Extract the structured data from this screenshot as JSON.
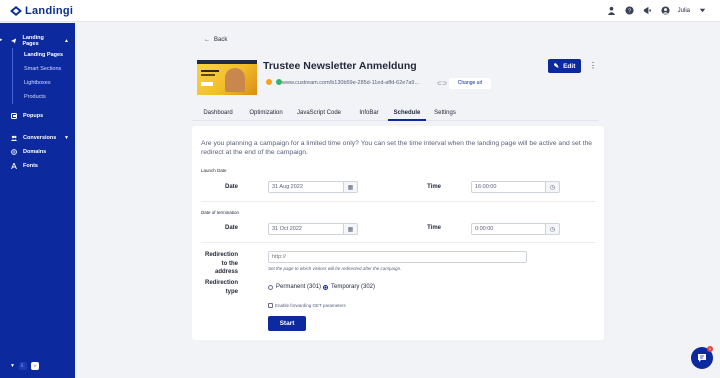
{
  "app": {
    "logo_text": "Landingi"
  },
  "header": {
    "user_name": "Julia"
  },
  "sidebar": {
    "landing_pages": "Landing Pages",
    "sub_items": [
      "Landing Pages",
      "Smart Sections",
      "Lightboxes",
      "Products"
    ],
    "popups": "Popups",
    "conversions": "Conversions",
    "domains": "Domains",
    "fonts": "Fonts"
  },
  "page": {
    "back": "Back",
    "title": "Trustee Newsletter Anmeldung",
    "url": "www.custream.com/b130b59e-285d-11ed-affd-62e7a9...",
    "change_url": "Change url",
    "edit": "Edit"
  },
  "tabs": [
    "Dashboard",
    "Optimization",
    "JavaScript Code",
    "InfoBar",
    "Schedule",
    "Settings"
  ],
  "active_tab": "Schedule",
  "schedule": {
    "intro": "Are you planning a campaign for a limited time only? You can set the time interval when the landing page will be active and set the redirect at the end of the campaign.",
    "launch_date_label": "Launch Date",
    "date_label": "Date",
    "time_label": "Time",
    "launch_date_value": "31 Aug 2022",
    "launch_time_value": "16:00:00",
    "termination_label": "Date of termination",
    "end_date_value": "31 Oct 2022",
    "end_time_value": "0:00:00",
    "redirection_label": "Redirection to the address",
    "redirection_placeholder": "http://",
    "redirection_hint": "Set the page to which visitors will be redirected after the campaign.",
    "redirection_type_label": "Redirection type",
    "permanent": "Permanent (301)",
    "temporary": "Temporary (302)",
    "forward_get": "Enable forwarding GET parameters",
    "start": "Start"
  },
  "chat_badge": "1",
  "colors": {
    "brand": "#0c2a9e",
    "status_dot_1": "#f2a21b",
    "status_dot_2": "#34b36b"
  }
}
